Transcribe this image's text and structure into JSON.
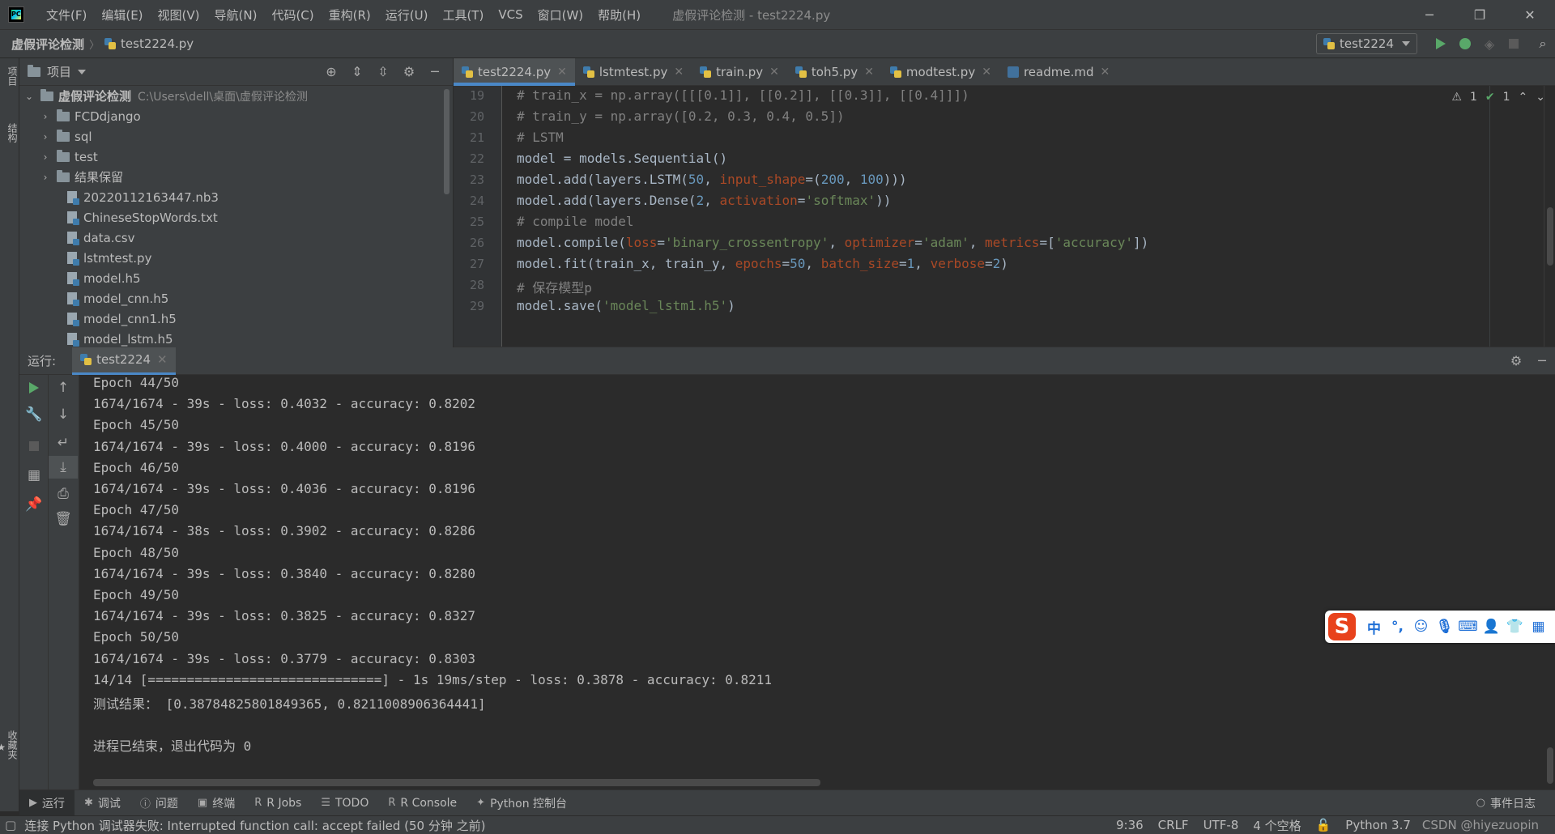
{
  "titlebar": {
    "menu": [
      "文件(F)",
      "编辑(E)",
      "视图(V)",
      "导航(N)",
      "代码(C)",
      "重构(R)",
      "运行(U)",
      "工具(T)",
      "VCS",
      "窗口(W)",
      "帮助(H)"
    ],
    "window_title": "虚假评论检测 - test2224.py"
  },
  "navbar": {
    "project": "虚假评论检测",
    "file": "test2224.py",
    "run_config": "test2224"
  },
  "left_strip": {
    "project_tab": "项目",
    "structure_tab": "结构",
    "favorites_tab": "收藏夹"
  },
  "project_panel": {
    "title": "项目",
    "root": {
      "name": "虚假评论检测",
      "path": "C:\\Users\\dell\\桌面\\虚假评论检测"
    },
    "items": [
      {
        "name": "FCDdjango",
        "kind": "folder"
      },
      {
        "name": "sql",
        "kind": "folder"
      },
      {
        "name": "test",
        "kind": "folder"
      },
      {
        "name": "结果保留",
        "kind": "folder"
      },
      {
        "name": "20220112163447.nb3",
        "kind": "file"
      },
      {
        "name": "ChineseStopWords.txt",
        "kind": "file"
      },
      {
        "name": "data.csv",
        "kind": "file"
      },
      {
        "name": "lstmtest.py",
        "kind": "file"
      },
      {
        "name": "model.h5",
        "kind": "file"
      },
      {
        "name": "model_cnn.h5",
        "kind": "file"
      },
      {
        "name": "model_cnn1.h5",
        "kind": "file"
      },
      {
        "name": "model_lstm.h5",
        "kind": "file"
      }
    ]
  },
  "editor": {
    "tabs": [
      "test2224.py",
      "lstmtest.py",
      "train.py",
      "toh5.py",
      "modtest.py",
      "readme.md"
    ],
    "inspections": {
      "warnings": "1",
      "ok": "1"
    },
    "line_numbers": [
      "19",
      "20",
      "21",
      "22",
      "23",
      "24",
      "25",
      "26",
      "27",
      "28",
      "29"
    ],
    "lines": [
      "# train_x = np.array([[[0.1]], [[0.2]], [[0.3]], [[0.4]]])",
      "# train_y = np.array([0.2, 0.3, 0.4, 0.5])",
      "# LSTM",
      "model = models.Sequential()",
      "model.add(layers.LSTM(50, input_shape=(200, 100)))",
      "model.add(layers.Dense(2, activation='softmax'))",
      "# compile model",
      "model.compile(loss='binary_crossentropy', optimizer='adam', metrics=['accuracy'])",
      "model.fit(train_x, train_y, epochs=50, batch_size=1, verbose=2)",
      "# 保存模型p",
      "model.save('model_lstm1.h5')"
    ]
  },
  "run_panel": {
    "label": "运行:",
    "tab": "test2224",
    "console": [
      "Epoch 44/50",
      "1674/1674 - 39s - loss: 0.4032 - accuracy: 0.8202",
      "Epoch 45/50",
      "1674/1674 - 39s - loss: 0.4000 - accuracy: 0.8196",
      "Epoch 46/50",
      "1674/1674 - 39s - loss: 0.4036 - accuracy: 0.8196",
      "Epoch 47/50",
      "1674/1674 - 38s - loss: 0.3902 - accuracy: 0.8286",
      "Epoch 48/50",
      "1674/1674 - 39s - loss: 0.3840 - accuracy: 0.8280",
      "Epoch 49/50",
      "1674/1674 - 39s - loss: 0.3825 - accuracy: 0.8327",
      "Epoch 50/50",
      "1674/1674 - 39s - loss: 0.3779 - accuracy: 0.8303",
      "14/14 [==============================] - 1s 19ms/step - loss: 0.3878 - accuracy: 0.8211",
      "测试结果： [0.38784825801849365, 0.8211008906364441]",
      "",
      "进程已结束，退出代码为 0"
    ]
  },
  "ime": {
    "logo": "S",
    "mode": "中"
  },
  "tool_tabs": [
    "运行",
    "调试",
    "问题",
    "终端",
    "R Jobs",
    "TODO",
    "R Console",
    "Python 控制台"
  ],
  "event_log": "事件日志",
  "statusbar": {
    "message": "连接 Python 调试器失败: Interrupted function call: accept failed (50 分钟 之前)",
    "position": "9:36",
    "line_sep": "CRLF",
    "encoding": "UTF-8",
    "indent": "4 个空格",
    "interpreter": "Python 3.7",
    "watermark": "CSDN @hiyezuopin"
  },
  "colors": {
    "bg": "#2b2b2b",
    "panel": "#3c3f41",
    "accent": "#4a88c7",
    "run_green": "#59a869",
    "keyword_arg": "#aa4926",
    "number": "#6897bb",
    "string": "#6a8759",
    "comment": "#808080"
  }
}
